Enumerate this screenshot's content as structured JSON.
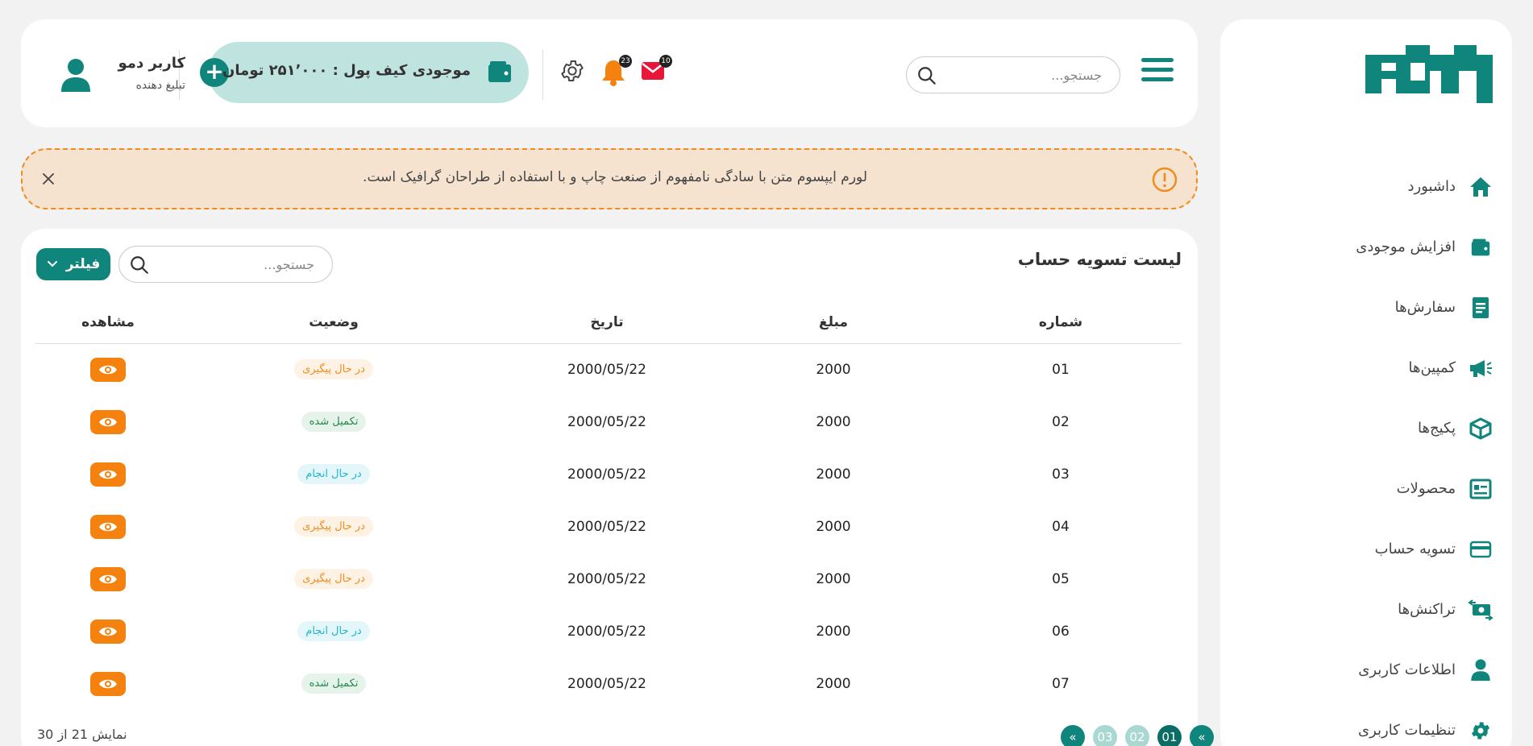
{
  "sidebar": {
    "items": [
      {
        "label": "داشبورد",
        "icon": "home-icon"
      },
      {
        "label": "افزایش موجودی",
        "icon": "wallet-icon"
      },
      {
        "label": "سفارش‌ها",
        "icon": "document-icon"
      },
      {
        "label": "کمپین‌ها",
        "icon": "megaphone-icon"
      },
      {
        "label": "پکیج‌ها",
        "icon": "box-icon"
      },
      {
        "label": "محصولات",
        "icon": "product-list-icon"
      },
      {
        "label": "تسویه حساب",
        "icon": "credit-card-icon"
      },
      {
        "label": "تراکنش‌ها",
        "icon": "money-exchange-icon"
      },
      {
        "label": "اطلاعات کاربری",
        "icon": "user-icon"
      },
      {
        "label": "تنظیمات کاربری",
        "icon": "gear-icon"
      }
    ]
  },
  "header": {
    "search_placeholder": "جستجو...",
    "mail_count": "10",
    "notification_count": "23",
    "wallet_text": "موجودی کیف پول : ۲۵۱٬۰۰۰ تومان",
    "add_symbol": "+",
    "user_name": "کاربر دمو",
    "user_role": "تبلیغ دهنده"
  },
  "alert": {
    "text": "لورم ایپسوم متن با سادگی نامفهوم از صنعت چاپ و با استفاده از طراحان گرافیک است."
  },
  "panel": {
    "title": "لیست تسویه حساب",
    "filter_label": "فیلتر",
    "search_placeholder": "جستجو...",
    "columns": [
      "شماره",
      "مبلغ",
      "تاریخ",
      "وضعیت",
      "مشاهده"
    ],
    "rows": [
      {
        "id": "01",
        "amount": "2000",
        "date": "2000/05/22",
        "status": "در حال پیگیری",
        "status_type": "pending"
      },
      {
        "id": "02",
        "amount": "2000",
        "date": "2000/05/22",
        "status": "تکمیل شده",
        "status_type": "done"
      },
      {
        "id": "03",
        "amount": "2000",
        "date": "2000/05/22",
        "status": "در حال انجام",
        "status_type": "progress"
      },
      {
        "id": "04",
        "amount": "2000",
        "date": "2000/05/22",
        "status": "در حال پیگیری",
        "status_type": "pending"
      },
      {
        "id": "05",
        "amount": "2000",
        "date": "2000/05/22",
        "status": "در حال پیگیری",
        "status_type": "pending"
      },
      {
        "id": "06",
        "amount": "2000",
        "date": "2000/05/22",
        "status": "در حال انجام",
        "status_type": "progress"
      },
      {
        "id": "07",
        "amount": "2000",
        "date": "2000/05/22",
        "status": "تکمیل شده",
        "status_type": "done"
      }
    ],
    "pagination": {
      "pages": [
        "01",
        "02",
        "03"
      ],
      "current": "01",
      "prev_symbol": "«",
      "next_symbol": "«"
    },
    "total_text": "نمایش 21 از 30"
  },
  "colors": {
    "brand": "#10857b",
    "accent_orange": "#f5820e",
    "alert_bg": "#f5e3cf",
    "wallet_bg": "#bfe3df",
    "mail": "#e8173a",
    "bell": "#f5820e"
  }
}
